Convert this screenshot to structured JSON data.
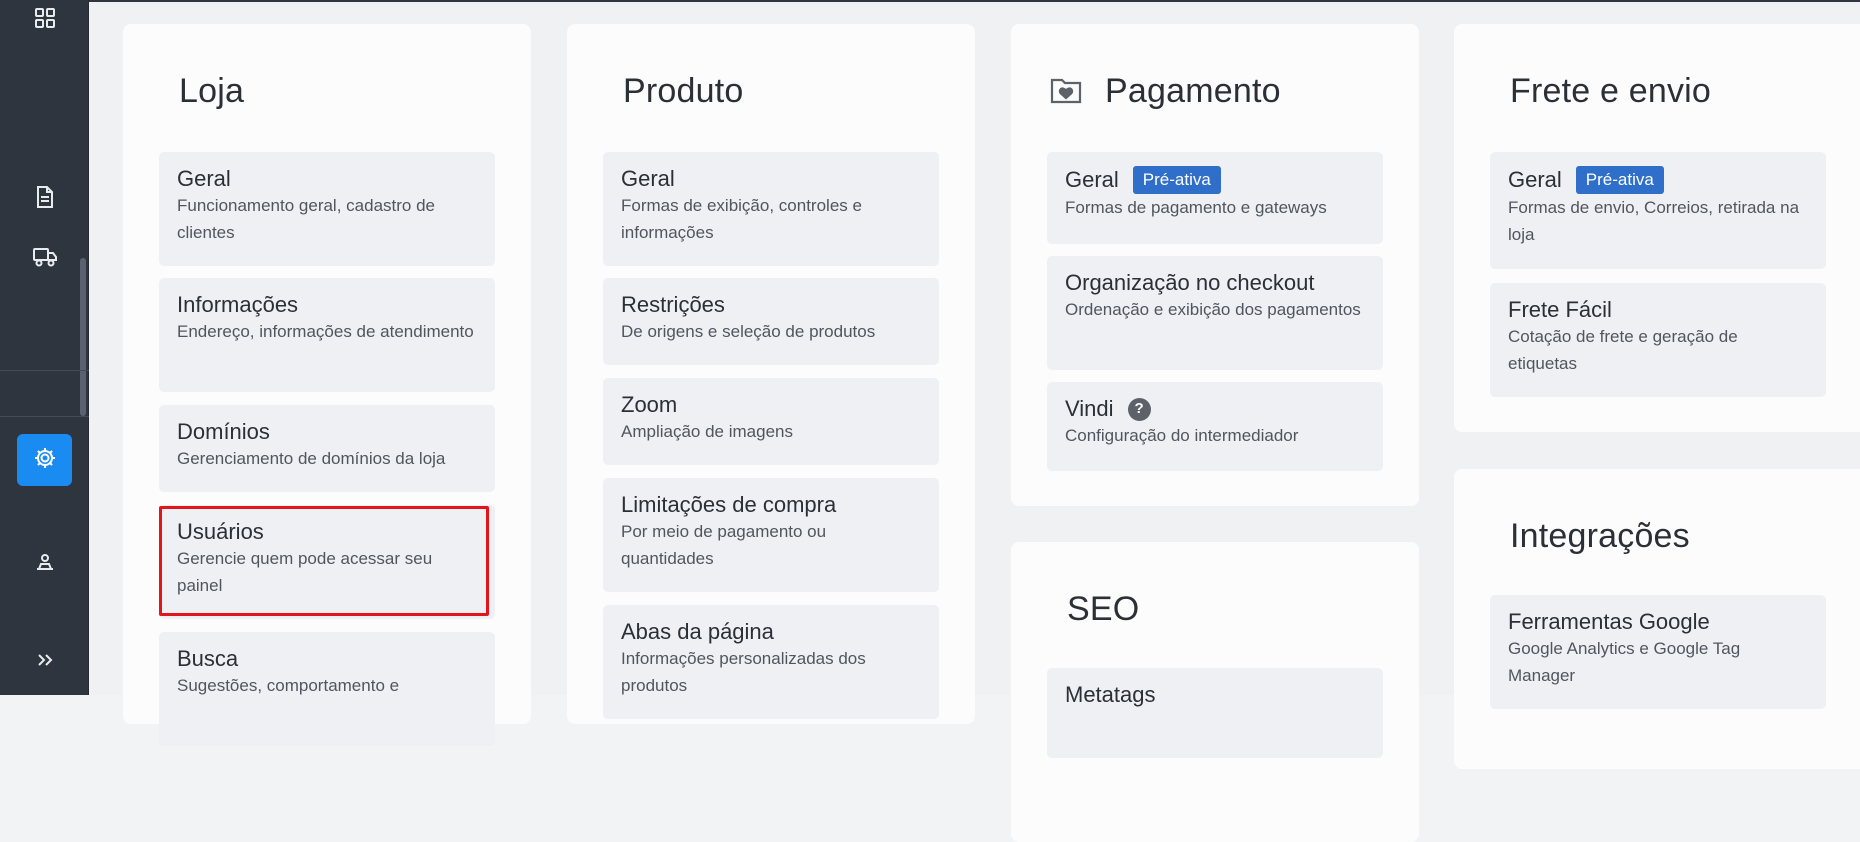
{
  "sidebar": {
    "icons": [
      "grid-icon",
      "document-icon",
      "truck-icon",
      "gear-icon",
      "customer-icon",
      "expand-icon"
    ],
    "active_color": "#1a8bf0"
  },
  "loja": {
    "title": "Loja",
    "items": [
      {
        "title": "Geral",
        "desc": "Funcionamento geral, cadastro de clientes"
      },
      {
        "title": "Informações",
        "desc": "Endereço, informações de atendimento"
      },
      {
        "title": "Domínios",
        "desc": "Gerenciamento de domínios da loja"
      },
      {
        "title": "Usuários",
        "desc": "Gerencie quem pode acessar seu painel"
      },
      {
        "title": "Busca",
        "desc": "Sugestões, comportamento e"
      }
    ]
  },
  "produto": {
    "title": "Produto",
    "items": [
      {
        "title": "Geral",
        "desc": "Formas de exibição, controles e informações"
      },
      {
        "title": "Restrições",
        "desc": "De origens e seleção de produtos"
      },
      {
        "title": "Zoom",
        "desc": "Ampliação de imagens"
      },
      {
        "title": "Limitações de compra",
        "desc": "Por meio de pagamento ou quantidades"
      },
      {
        "title": "Abas da página",
        "desc": "Informações personalizadas dos produtos"
      }
    ]
  },
  "pagamento": {
    "title": "Pagamento",
    "items": [
      {
        "title": "Geral",
        "badge": "Pré-ativa",
        "desc": "Formas de pagamento e gateways"
      },
      {
        "title": "Organização no checkout",
        "desc": "Ordenação e exibição dos pagamentos"
      },
      {
        "title": "Vindi",
        "help": "?",
        "desc": "Configuração do intermediador"
      }
    ]
  },
  "seo": {
    "title": "SEO",
    "items": [
      {
        "title": "Metatags"
      }
    ]
  },
  "frete": {
    "title": "Frete e envio",
    "items": [
      {
        "title": "Geral",
        "badge": "Pré-ativa",
        "desc": "Formas de envio, Correios, retirada na loja"
      },
      {
        "title": "Frete Fácil",
        "desc": "Cotação de frete e geração de etiquetas"
      }
    ]
  },
  "integracoes": {
    "title": "Integrações",
    "items": [
      {
        "title": "Ferramentas Google",
        "desc": "Google Analytics e Google Tag Manager"
      }
    ]
  },
  "colors": {
    "badge": "#2f6fc9",
    "highlight": "#e3141b",
    "sidebar": "#2f353e"
  }
}
